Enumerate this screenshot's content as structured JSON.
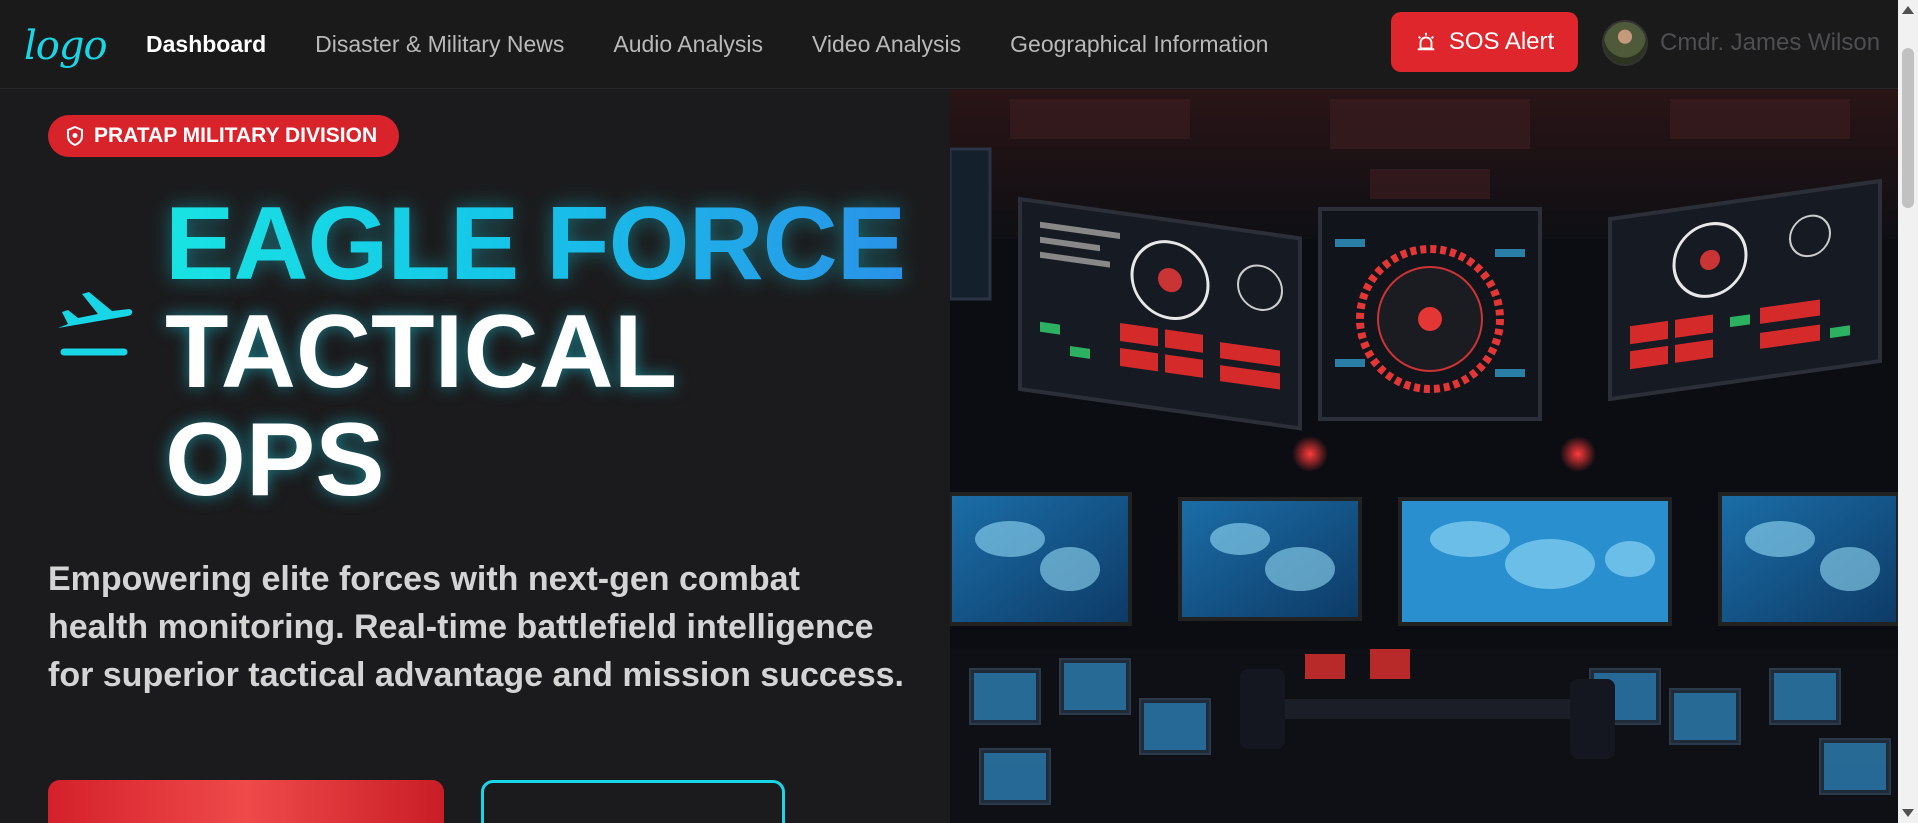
{
  "nav": {
    "logo_text": "logo",
    "items": [
      {
        "label": "Dashboard",
        "active": true
      },
      {
        "label": "Disaster & Military News",
        "active": false
      },
      {
        "label": "Audio Analysis",
        "active": false
      },
      {
        "label": "Video Analysis",
        "active": false
      },
      {
        "label": "Geographical Information",
        "active": false
      }
    ],
    "sos_label": "SOS Alert",
    "user_name": "Cmdr. James Wilson"
  },
  "hero": {
    "badge": "PRATAP MILITARY DIVISION",
    "title_line1": "EAGLE FORCE",
    "title_line2": "TACTICAL",
    "title_line3": "OPS",
    "tagline": "Empowering elite forces with next-gen combat health monitoring. Real-time battlefield intelligence for superior tactical advantage and mission success.",
    "image_description_icon": "command-center-image"
  },
  "colors": {
    "accent_cyan": "#18d6e6",
    "alert_red": "#e0262d",
    "background": "#1b1b1d"
  }
}
